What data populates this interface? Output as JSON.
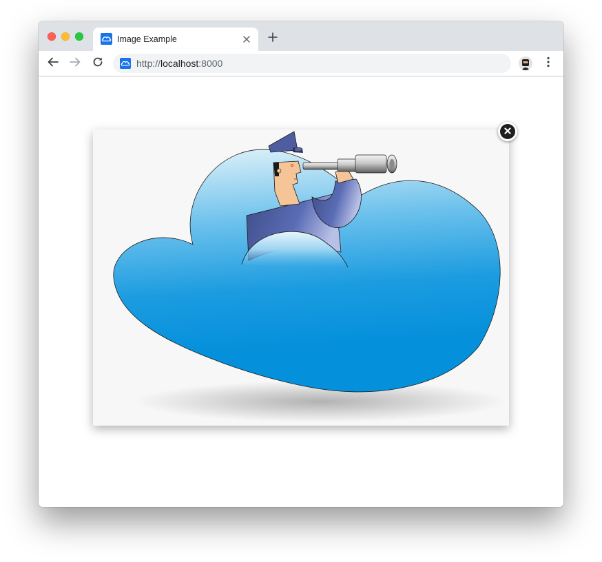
{
  "browser": {
    "tab": {
      "title": "Image Example",
      "favicon": "cloud-icon"
    },
    "new_tab_icon": "plus-icon",
    "address_bar": {
      "scheme": "http://",
      "host": "localhost",
      "port": ":8000"
    }
  },
  "lightbox": {
    "image": {
      "subject": "sailor-with-telescope-in-cloud"
    },
    "close_icon": "close-icon"
  },
  "colors": {
    "tabbar": "#dee1e6",
    "favicon_blue": "#1a73e8",
    "cloud_top": "#c9e8f6",
    "cloud_bottom": "#0e94dc"
  }
}
